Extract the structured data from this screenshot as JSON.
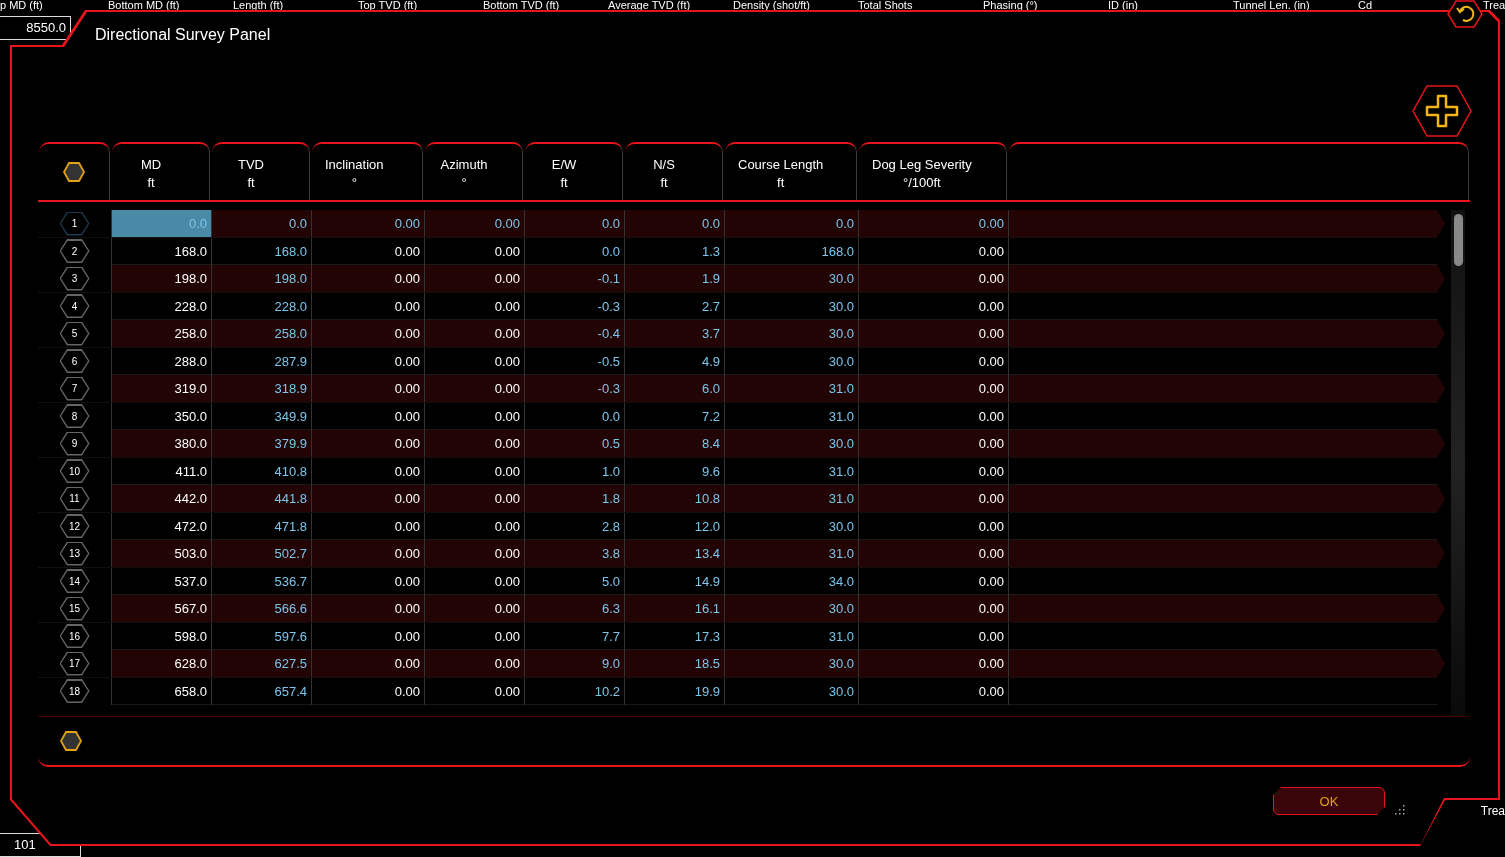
{
  "background": {
    "column_headers": [
      "p MD (ft)",
      "Bottom MD (ft)",
      "Length (ft)",
      "Top TVD (ft)",
      "Bottom TVD (ft)",
      "Average TVD (ft)",
      "Density (shot/ft)",
      "Total Shots",
      "Phasing (°)",
      "ID (in)",
      "Tunnel Len. (in)",
      "Cd",
      "Trea"
    ],
    "top_field": "8550.0",
    "bottom_field": "101",
    "side_label": "Trea"
  },
  "panel": {
    "title": "Directional Survey Panel",
    "ok_button": "OK"
  },
  "table": {
    "columns": [
      {
        "label": "MD",
        "unit": "ft",
        "kind": "input"
      },
      {
        "label": "TVD",
        "unit": "ft",
        "kind": "calculated"
      },
      {
        "label": "Inclination",
        "unit": "°",
        "kind": "input"
      },
      {
        "label": "Azimuth",
        "unit": "°",
        "kind": "input"
      },
      {
        "label": "E/W",
        "unit": "ft",
        "kind": "calculated"
      },
      {
        "label": "N/S",
        "unit": "ft",
        "kind": "calculated"
      },
      {
        "label": "Course Length",
        "unit": "ft",
        "kind": "calculated"
      },
      {
        "label": "Dog Leg Severity",
        "unit": "°/100ft",
        "kind": "input"
      }
    ],
    "rows": [
      {
        "number": "1",
        "selected": true,
        "locked": true,
        "cells": [
          "0.0",
          "0.0",
          "0.00",
          "0.00",
          "0.0",
          "0.0",
          "0.0",
          "0.00"
        ]
      },
      {
        "number": "2",
        "selected": false,
        "locked": false,
        "cells": [
          "168.0",
          "168.0",
          "0.00",
          "0.00",
          "0.0",
          "1.3",
          "168.0",
          "0.00"
        ]
      },
      {
        "number": "3",
        "selected": false,
        "locked": false,
        "cells": [
          "198.0",
          "198.0",
          "0.00",
          "0.00",
          "-0.1",
          "1.9",
          "30.0",
          "0.00"
        ]
      },
      {
        "number": "4",
        "selected": false,
        "locked": false,
        "cells": [
          "228.0",
          "228.0",
          "0.00",
          "0.00",
          "-0.3",
          "2.7",
          "30.0",
          "0.00"
        ]
      },
      {
        "number": "5",
        "selected": false,
        "locked": false,
        "cells": [
          "258.0",
          "258.0",
          "0.00",
          "0.00",
          "-0.4",
          "3.7",
          "30.0",
          "0.00"
        ]
      },
      {
        "number": "6",
        "selected": false,
        "locked": false,
        "cells": [
          "288.0",
          "287.9",
          "0.00",
          "0.00",
          "-0.5",
          "4.9",
          "30.0",
          "0.00"
        ]
      },
      {
        "number": "7",
        "selected": false,
        "locked": false,
        "cells": [
          "319.0",
          "318.9",
          "0.00",
          "0.00",
          "-0.3",
          "6.0",
          "31.0",
          "0.00"
        ]
      },
      {
        "number": "8",
        "selected": false,
        "locked": false,
        "cells": [
          "350.0",
          "349.9",
          "0.00",
          "0.00",
          "0.0",
          "7.2",
          "31.0",
          "0.00"
        ]
      },
      {
        "number": "9",
        "selected": false,
        "locked": false,
        "cells": [
          "380.0",
          "379.9",
          "0.00",
          "0.00",
          "0.5",
          "8.4",
          "30.0",
          "0.00"
        ]
      },
      {
        "number": "10",
        "selected": false,
        "locked": false,
        "cells": [
          "411.0",
          "410.8",
          "0.00",
          "0.00",
          "1.0",
          "9.6",
          "31.0",
          "0.00"
        ]
      },
      {
        "number": "11",
        "selected": false,
        "locked": false,
        "cells": [
          "442.0",
          "441.8",
          "0.00",
          "0.00",
          "1.8",
          "10.8",
          "31.0",
          "0.00"
        ]
      },
      {
        "number": "12",
        "selected": false,
        "locked": false,
        "cells": [
          "472.0",
          "471.8",
          "0.00",
          "0.00",
          "2.8",
          "12.0",
          "30.0",
          "0.00"
        ]
      },
      {
        "number": "13",
        "selected": false,
        "locked": false,
        "cells": [
          "503.0",
          "502.7",
          "0.00",
          "0.00",
          "3.8",
          "13.4",
          "31.0",
          "0.00"
        ]
      },
      {
        "number": "14",
        "selected": false,
        "locked": false,
        "cells": [
          "537.0",
          "536.7",
          "0.00",
          "0.00",
          "5.0",
          "14.9",
          "34.0",
          "0.00"
        ]
      },
      {
        "number": "15",
        "selected": false,
        "locked": false,
        "cells": [
          "567.0",
          "566.6",
          "0.00",
          "0.00",
          "6.3",
          "16.1",
          "30.0",
          "0.00"
        ]
      },
      {
        "number": "16",
        "selected": false,
        "locked": false,
        "cells": [
          "598.0",
          "597.6",
          "0.00",
          "0.00",
          "7.7",
          "17.3",
          "31.0",
          "0.00"
        ]
      },
      {
        "number": "17",
        "selected": false,
        "locked": false,
        "cells": [
          "628.0",
          "627.5",
          "0.00",
          "0.00",
          "9.0",
          "18.5",
          "30.0",
          "0.00"
        ]
      },
      {
        "number": "18",
        "selected": false,
        "locked": false,
        "cells": [
          "658.0",
          "657.4",
          "0.00",
          "0.00",
          "10.2",
          "19.9",
          "30.0",
          "0.00"
        ]
      }
    ]
  }
}
